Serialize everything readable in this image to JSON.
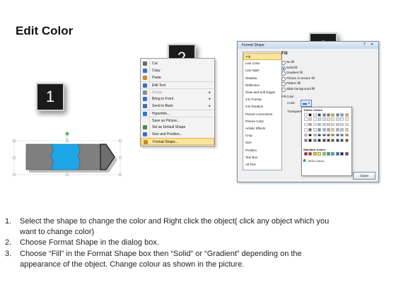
{
  "title": "Edit Color",
  "badges": [
    "1",
    "2",
    "3"
  ],
  "context_menu": {
    "items": [
      {
        "label": "Cut",
        "icon": "scissors-icon",
        "key": "C"
      },
      {
        "label": "Copy",
        "icon": "copy-icon",
        "key": "C"
      },
      {
        "label": "Paste",
        "icon": "paste-icon",
        "key": "P"
      },
      {
        "label": "Edit Text",
        "icon": "edit-text-icon",
        "key": "x"
      },
      {
        "label": "Group",
        "icon": "group-icon",
        "key": "G",
        "disabled": true,
        "submenu": true
      },
      {
        "label": "Bring to Front",
        "icon": "bring-front-icon",
        "key": "F",
        "submenu": true
      },
      {
        "label": "Send to Back",
        "icon": "send-back-icon",
        "key": "k",
        "submenu": true
      },
      {
        "label": "Hyperlink...",
        "icon": "hyperlink-icon",
        "key": "H"
      },
      {
        "label": "Save as Picture...",
        "icon": "",
        "key": ""
      },
      {
        "label": "Set as Default Shape",
        "icon": "default-shape-icon",
        "key": "D"
      },
      {
        "label": "Size and Position...",
        "icon": "size-position-icon",
        "key": "z"
      },
      {
        "label": "Format Shape...",
        "icon": "format-shape-icon",
        "key": "o",
        "highlighted": true
      }
    ]
  },
  "dialog": {
    "title": "Format Shape",
    "categories": [
      "Fill",
      "Line Color",
      "Line Style",
      "Shadow",
      "Reflection",
      "Glow and Soft Edges",
      "3-D Format",
      "3-D Rotation",
      "Picture Corrections",
      "Picture Color",
      "Artistic Effects",
      "Crop",
      "Size",
      "Position",
      "Text Box",
      "Alt Text"
    ],
    "selected_category": "Fill",
    "section_title": "Fill",
    "fill_options": [
      {
        "label": "No fill",
        "checked": false
      },
      {
        "label": "Solid fill",
        "checked": true
      },
      {
        "label": "Gradient fill",
        "checked": false
      },
      {
        "label": "Picture or texture fill",
        "checked": false
      },
      {
        "label": "Pattern fill",
        "checked": false
      },
      {
        "label": "Slide background fill",
        "checked": false
      }
    ],
    "fill_color_label": "Fill Color",
    "color_label": "Color:",
    "transparency_label": "Transparency:",
    "close_label": "Close"
  },
  "palette": {
    "theme_title": "Theme Colors",
    "standard_title": "Standard Colors",
    "more_colors": "More Colors...",
    "theme_top": [
      "#ffffff",
      "#000000",
      "#eeece1",
      "#1f497d",
      "#4f81bd",
      "#c0504d",
      "#9bbb59",
      "#8064a2",
      "#4bacc6",
      "#f79646"
    ],
    "standard": [
      "#c00000",
      "#ff0000",
      "#ffc000",
      "#ffff00",
      "#92d050",
      "#00b050",
      "#00b0f0",
      "#0070c0",
      "#002060",
      "#7030a0"
    ]
  },
  "steps": [
    {
      "num": "1.",
      "lines": [
        "Select the shape to change the color and Right click the object( click any object which you",
        "want to change color)"
      ]
    },
    {
      "num": "2.",
      "lines": [
        "Choose Format Shape in the dialog box."
      ]
    },
    {
      "num": "3.",
      "lines": [
        "Choose “Fill” in the Format Shape box then “Solid” or “Gradient” depending on the",
        "appearance of the object. Change colour as shown in the picture."
      ]
    }
  ],
  "colors": {
    "shape_gray": "#7f7f7f",
    "shape_blue": "#1ea7e8",
    "highlight": "#fbe59a"
  }
}
